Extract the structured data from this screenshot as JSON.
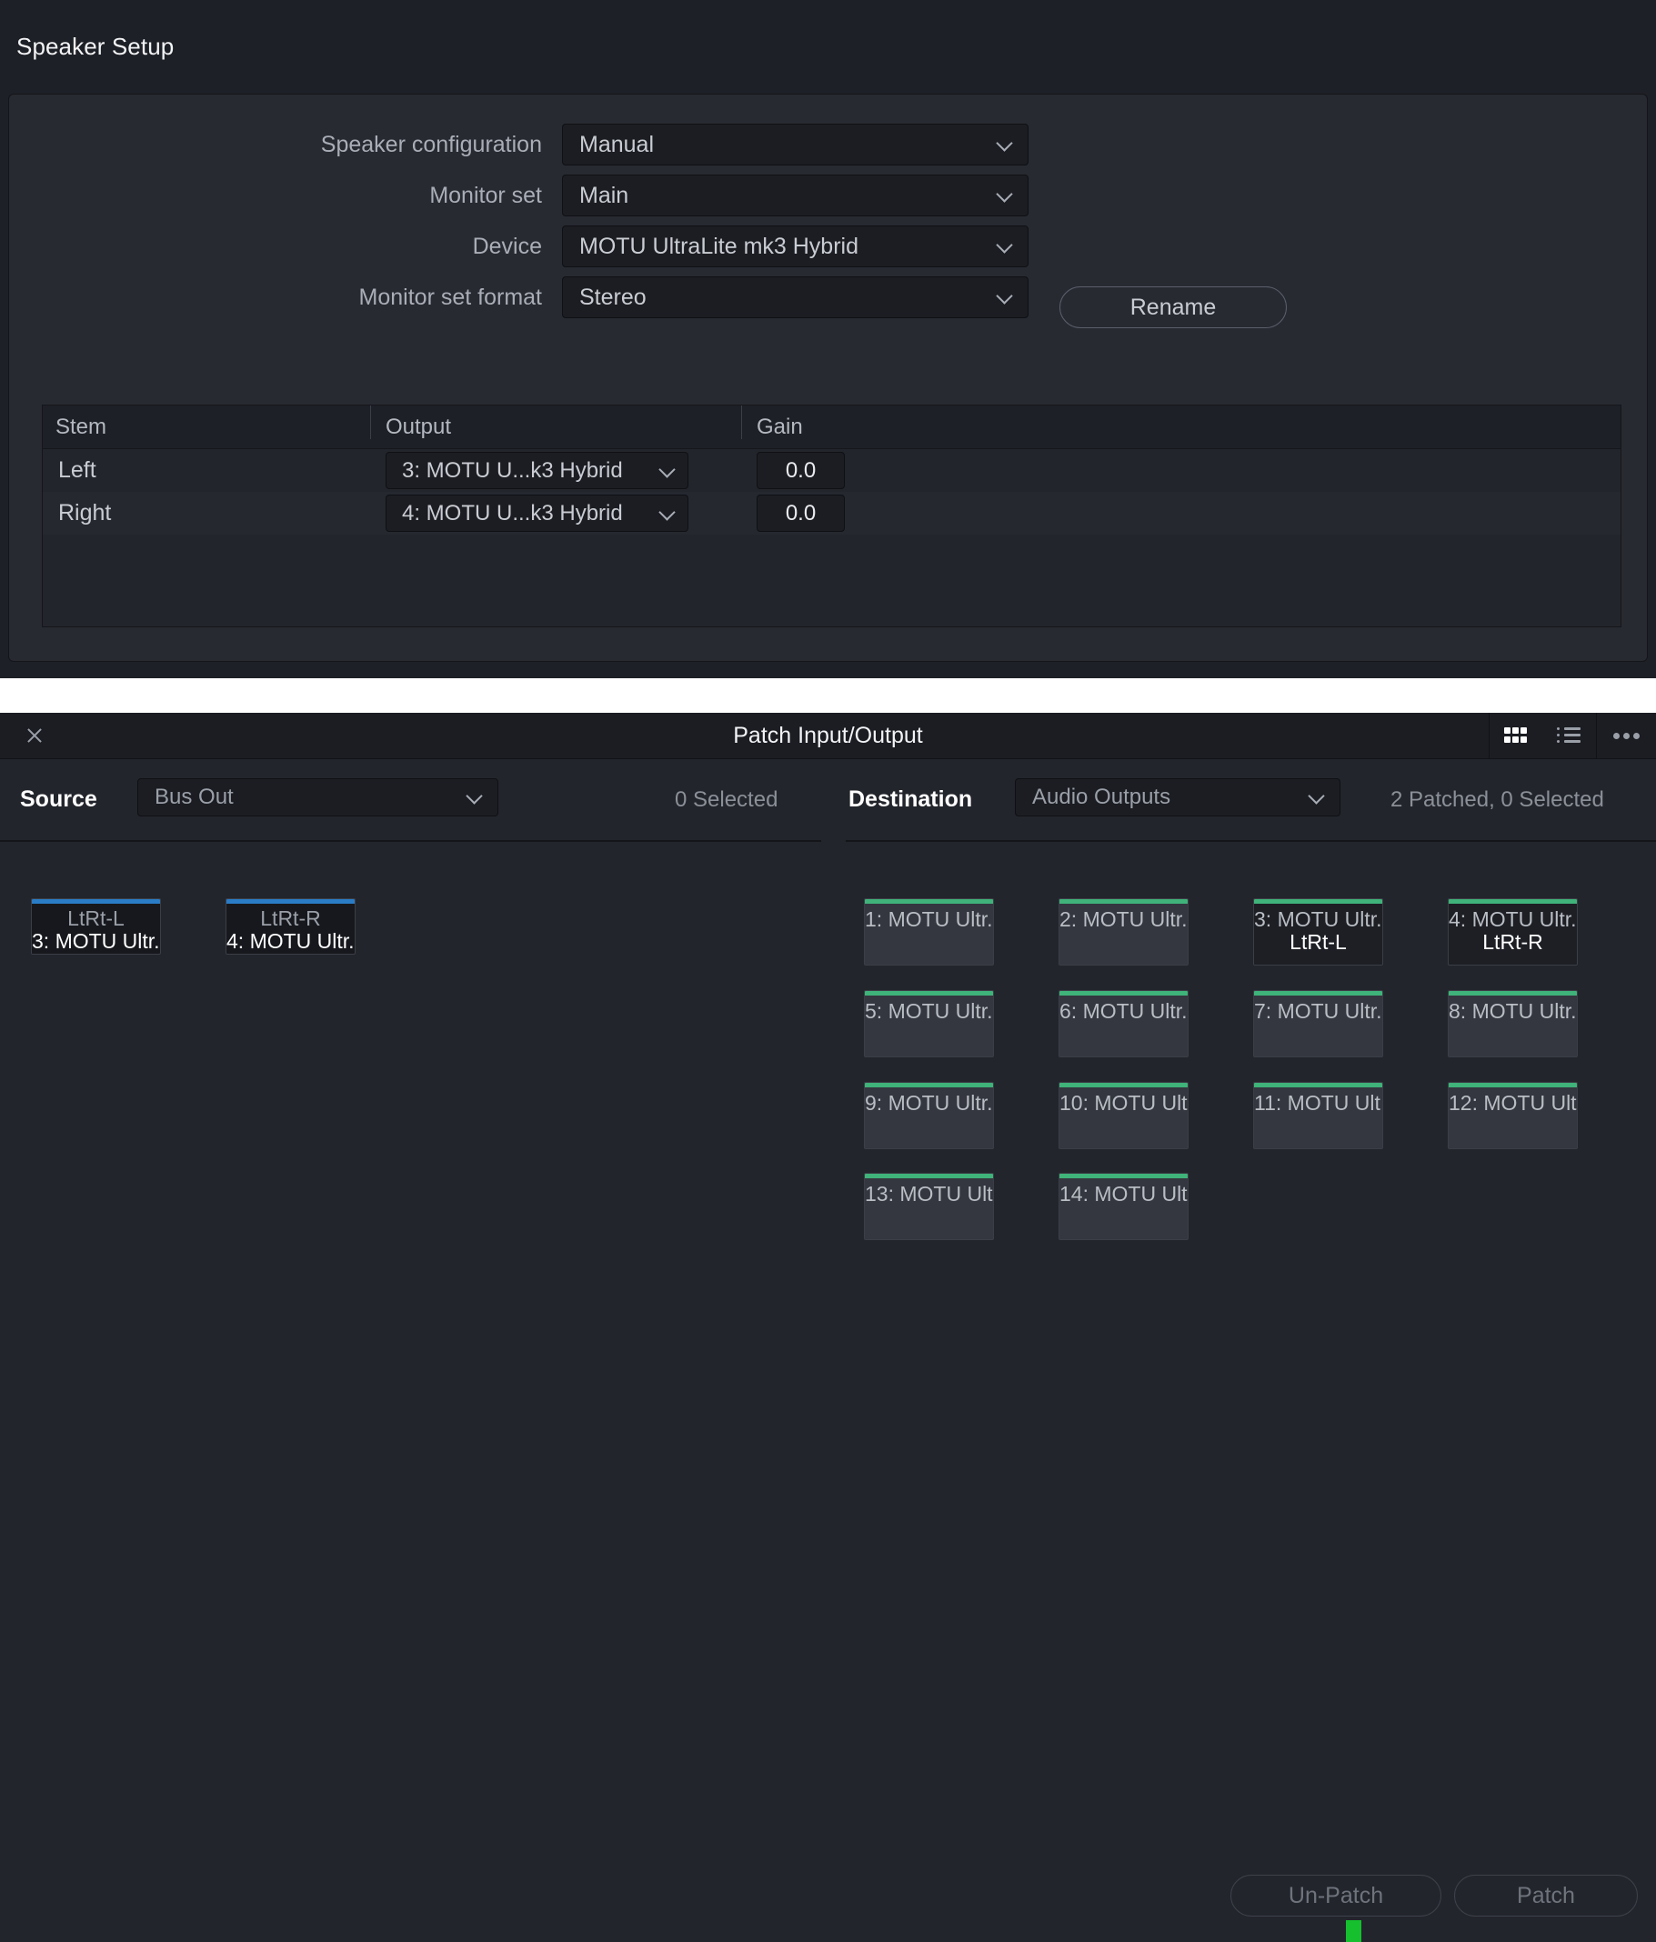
{
  "speaker_setup": {
    "title": "Speaker Setup",
    "fields": [
      {
        "label": "Speaker configuration",
        "value": "Manual"
      },
      {
        "label": "Monitor set",
        "value": "Main"
      },
      {
        "label": "Device",
        "value": "MOTU UltraLite mk3 Hybrid"
      },
      {
        "label": "Monitor set format",
        "value": "Stereo"
      }
    ],
    "rename_label": "Rename",
    "table": {
      "columns": [
        "Stem",
        "Output",
        "Gain"
      ],
      "rows": [
        {
          "stem": "Left",
          "output": "3: MOTU U...k3 Hybrid",
          "gain": "0.0"
        },
        {
          "stem": "Right",
          "output": "4: MOTU U...k3 Hybrid",
          "gain": "0.0"
        }
      ]
    }
  },
  "patch": {
    "title": "Patch Input/Output",
    "close_label": "×",
    "view_grid_icon": "grid-view-icon",
    "view_list_icon": "list-view-icon",
    "more_icon": "more-options-icon",
    "source": {
      "label": "Source",
      "select_value": "Bus Out",
      "count_text": "0 Selected",
      "tiles": [
        {
          "top": "LtRt-L",
          "bottom": "3: MOTU Ultr..."
        },
        {
          "top": "LtRt-R",
          "bottom": "4: MOTU Ultr..."
        }
      ]
    },
    "destination": {
      "label": "Destination",
      "select_value": "Audio Outputs",
      "count_text": "2 Patched, 0 Selected",
      "tiles": [
        {
          "top": "1: MOTU Ultr...",
          "bottom": "",
          "patched": false
        },
        {
          "top": "2: MOTU Ultr...",
          "bottom": "",
          "patched": false
        },
        {
          "top": "3: MOTU Ultr...",
          "bottom": "LtRt-L",
          "patched": true
        },
        {
          "top": "4: MOTU Ultr...",
          "bottom": "LtRt-R",
          "patched": true
        },
        {
          "top": "5: MOTU Ultr...",
          "bottom": "",
          "patched": false
        },
        {
          "top": "6: MOTU Ultr...",
          "bottom": "",
          "patched": false
        },
        {
          "top": "7: MOTU Ultr...",
          "bottom": "",
          "patched": false
        },
        {
          "top": "8: MOTU Ultr...",
          "bottom": "",
          "patched": false
        },
        {
          "top": "9: MOTU Ultr...",
          "bottom": "",
          "patched": false
        },
        {
          "top": "10: MOTU Ult...",
          "bottom": "",
          "patched": false
        },
        {
          "top": "11: MOTU Ult...",
          "bottom": "",
          "patched": false
        },
        {
          "top": "12: MOTU Ult...",
          "bottom": "",
          "patched": false
        },
        {
          "top": "13: MOTU Ult...",
          "bottom": "",
          "patched": false
        },
        {
          "top": "14: MOTU Ult...",
          "bottom": "",
          "patched": false
        }
      ]
    },
    "unpatch_label": "Un-Patch",
    "patch_label": "Patch"
  },
  "colors": {
    "source_accent": "#2a7cc7",
    "destination_accent": "#3fb37a",
    "marker_green": "#15bf2e",
    "panel_bg": "#23252c",
    "window_bg": "#1e2027"
  }
}
